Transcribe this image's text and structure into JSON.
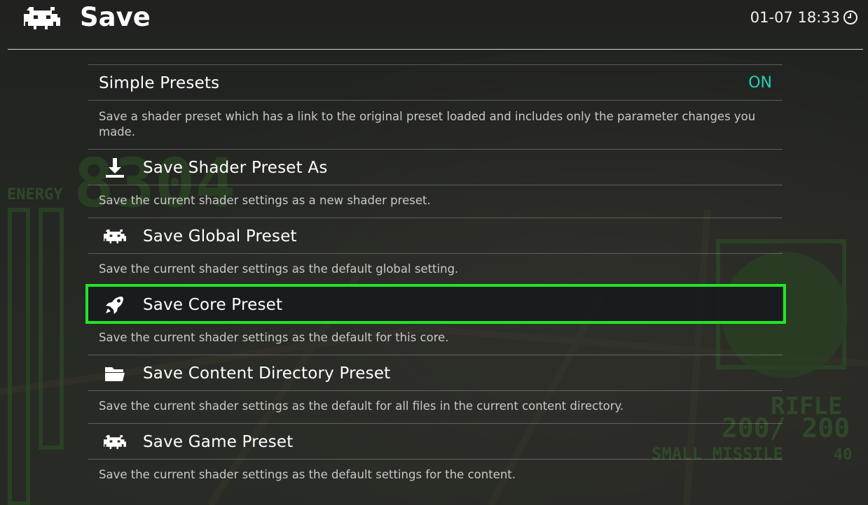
{
  "header": {
    "title": "Save",
    "clock": "01-07 18:33",
    "logo_icon": "retroarch-invader-icon",
    "clock_icon": "clock-icon"
  },
  "menu": {
    "items": [
      {
        "label": "Simple Presets",
        "value": "ON",
        "description": "Save a shader preset which has a link to the original preset loaded and includes only the parameter changes you made.",
        "icon": null
      },
      {
        "label": "Save Shader Preset As",
        "description": "Save the current shader settings as a new shader preset.",
        "icon": "download-icon"
      },
      {
        "label": "Save Global Preset",
        "description": "Save the current shader settings as the default global setting.",
        "icon": "retroarch-invader-icon"
      },
      {
        "label": "Save Core Preset",
        "description": "Save the current shader settings as the default for this core.",
        "icon": "rocket-icon",
        "selected": true
      },
      {
        "label": "Save Content Directory Preset",
        "description": "Save the current shader settings as the default for all files in the current content directory.",
        "icon": "folder-icon"
      },
      {
        "label": "Save Game Preset",
        "description": "Save the current shader settings as the default settings for the content.",
        "icon": "retroarch-invader-icon"
      }
    ]
  },
  "colors": {
    "accent_on": "#21d1b2",
    "selection_border": "#21e52a",
    "hud_green": "#4e8a3e"
  }
}
